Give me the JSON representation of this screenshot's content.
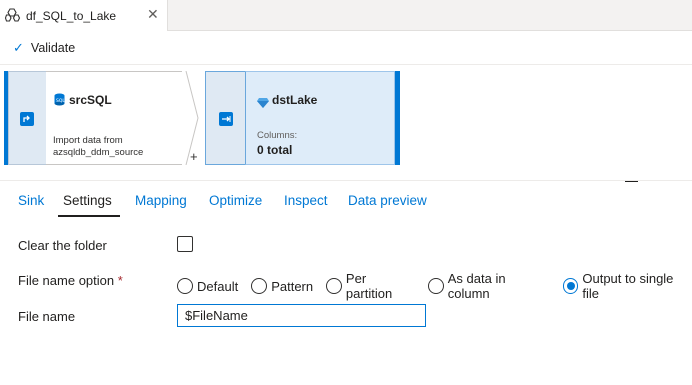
{
  "tab": {
    "title": "df_SQL_to_Lake",
    "icon": "dataflow-icon",
    "close_icon": "close-icon"
  },
  "toolbar": {
    "validate_label": "Validate",
    "validate_icon": "checkmark-icon"
  },
  "canvas": {
    "source": {
      "name": "srcSQL",
      "description_line1": "Import data from",
      "description_line2": "azsqldb_ddm_source",
      "icon": "sql-database-icon"
    },
    "sink": {
      "name": "dstLake",
      "columns_label": "Columns:",
      "columns_value": "0 total",
      "icon": "lake-icon"
    },
    "add_symbol": "+",
    "accent_color": "#0078d4"
  },
  "panel_tabs": [
    {
      "label": "Sink",
      "active": false
    },
    {
      "label": "Settings",
      "active": true
    },
    {
      "label": "Mapping",
      "active": false
    },
    {
      "label": "Optimize",
      "active": false
    },
    {
      "label": "Inspect",
      "active": false
    },
    {
      "label": "Data preview",
      "active": false
    }
  ],
  "settings": {
    "clear_folder": {
      "label": "Clear the folder",
      "checked": false
    },
    "file_name_option": {
      "label": "File name option",
      "required_mark": "*",
      "options": [
        "Default",
        "Pattern",
        "Per partition",
        "As data in column",
        "Output to single file"
      ],
      "selected": "Output to single file"
    },
    "file_name": {
      "label": "File name",
      "value": "$FileName"
    }
  }
}
